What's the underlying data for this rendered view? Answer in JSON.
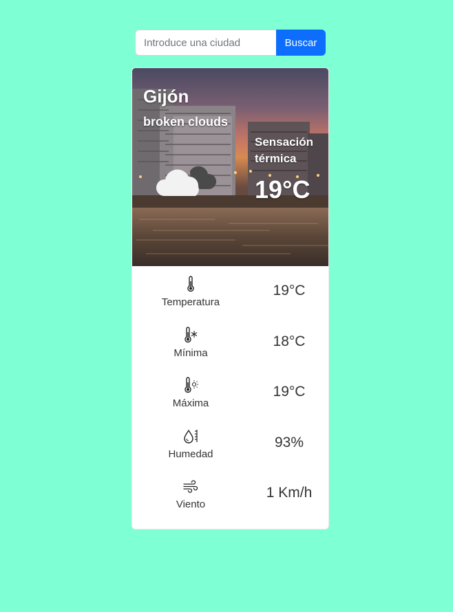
{
  "search": {
    "placeholder": "Introduce una ciudad",
    "value": "",
    "button_label": "Buscar"
  },
  "weather": {
    "city": "Gijón",
    "description": "broken clouds",
    "feels_like_label": "Sensación térmica",
    "feels_like_value": "19°C",
    "icon": "broken-clouds-icon"
  },
  "details": [
    {
      "icon": "thermometer-icon",
      "label": "Temperatura",
      "value": "19°C"
    },
    {
      "icon": "thermometer-snow-icon",
      "label": "Mínima",
      "value": "18°C"
    },
    {
      "icon": "thermometer-sun-icon",
      "label": "Máxima",
      "value": "19°C"
    },
    {
      "icon": "moisture-icon",
      "label": "Humedad",
      "value": "93%"
    },
    {
      "icon": "wind-icon",
      "label": "Viento",
      "value": "1 Km/h"
    }
  ],
  "colors": {
    "page_background": "#7fffd4",
    "button": "#0d6efd",
    "card": "#ffffff",
    "text": "#333333"
  }
}
